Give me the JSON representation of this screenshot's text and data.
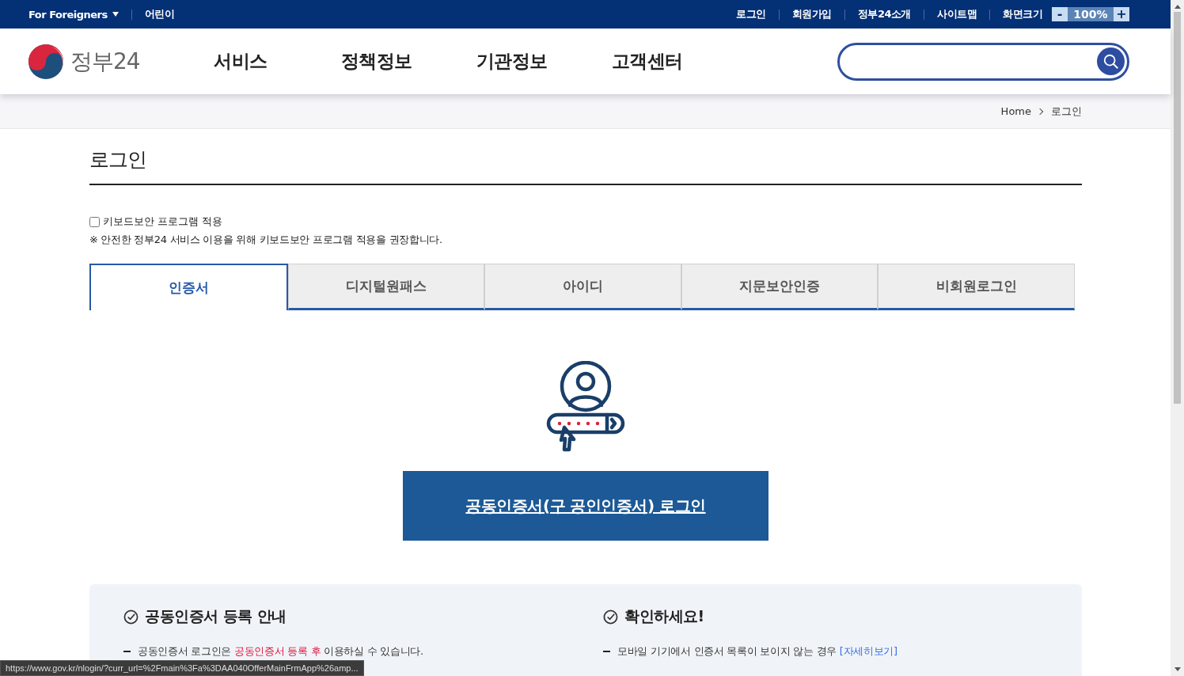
{
  "top_bar": {
    "left_links": [
      {
        "label": "For Foreigners",
        "dropdown": true
      },
      {
        "label": "어린이",
        "dropdown": false
      }
    ],
    "right_links": [
      "로그인",
      "회원가입",
      "정부24소개",
      "사이트맵"
    ],
    "zoom": {
      "label": "화면크기",
      "minus": "-",
      "value": "100%",
      "plus": "+"
    }
  },
  "header": {
    "logo": "정부24",
    "nav": [
      "서비스",
      "정책정보",
      "기관정보",
      "고객센터"
    ]
  },
  "breadcrumb": [
    "Home",
    "로그인"
  ],
  "page_title": "로그인",
  "keyboard_security": {
    "label": "키보드보안 프로그램 적용",
    "checked": false
  },
  "notice": "※ 안전한 정부24 서비스 이용을 위해 키보드보안 프로그램 적용을 권장합니다.",
  "tabs": [
    {
      "label": "인증서",
      "selected": true
    },
    {
      "label": "디지털원패스",
      "selected": false
    },
    {
      "label": "아이디",
      "selected": false
    },
    {
      "label": "지문보안인증",
      "selected": false
    },
    {
      "label": "비회원로그인",
      "selected": false
    }
  ],
  "login_button": "공동인증서(구 공인인증서) 로그인",
  "info_panels": [
    {
      "title": "공동인증서 등록 안내",
      "items": [
        [
          {
            "text": "공동인증서 로그인은 ",
            "kind": "plain"
          },
          {
            "text": "공동인증서 등록 후",
            "kind": "emphasis"
          },
          {
            "text": " 이용하실 수 있습니다.",
            "kind": "plain"
          }
        ]
      ]
    },
    {
      "title": "확인하세요!",
      "items": [
        [
          {
            "text": "모바일 기기에서 인증서 목록이 보이지 않는 경우 ",
            "kind": "plain"
          },
          {
            "text": "[자세히보기]",
            "kind": "link"
          }
        ]
      ]
    }
  ],
  "status_url": "https://www.gov.kr/nlogin/?curr_url=%2Fmain%3Fa%3DAA040OfferMainFrmApp%26amp..."
}
